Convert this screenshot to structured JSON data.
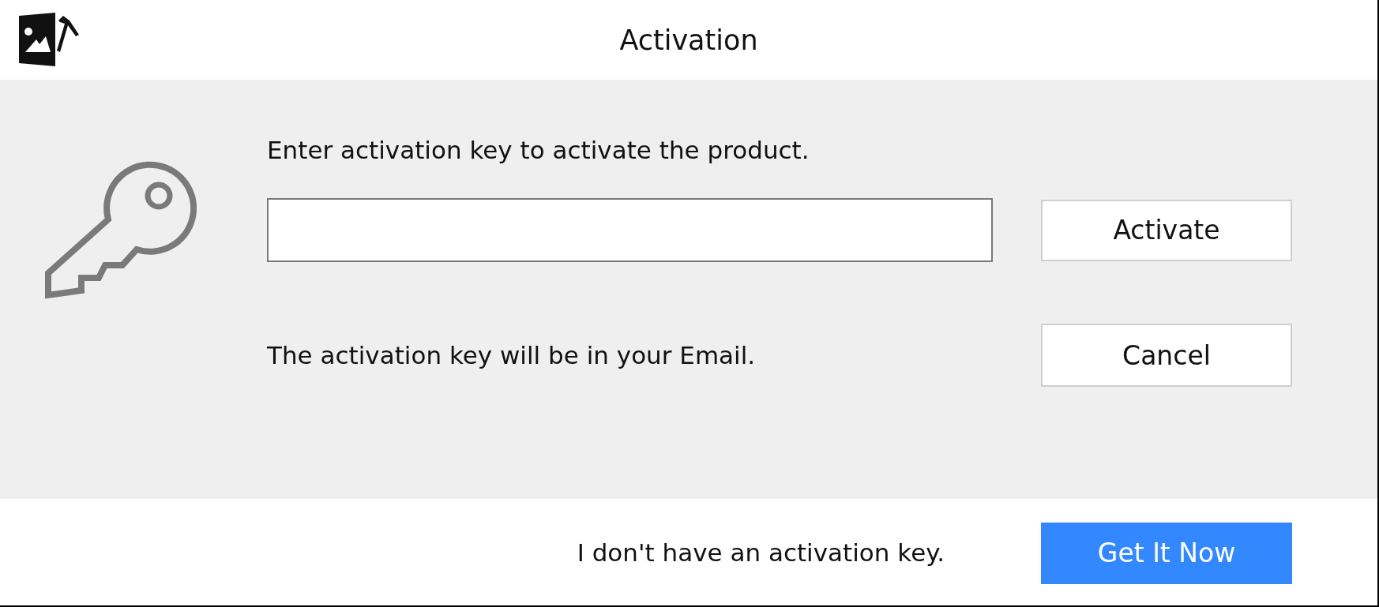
{
  "window": {
    "title": "Activation"
  },
  "prompt": "Enter activation key to activate the product.",
  "note": "The activation key will be in your Email.",
  "buttons": [
    {
      "label": "Activate"
    },
    {
      "label": "Cancel"
    }
  ],
  "footer": {
    "text": "I don't have an activation key.",
    "button": {
      "label": "Get It Now"
    }
  }
}
